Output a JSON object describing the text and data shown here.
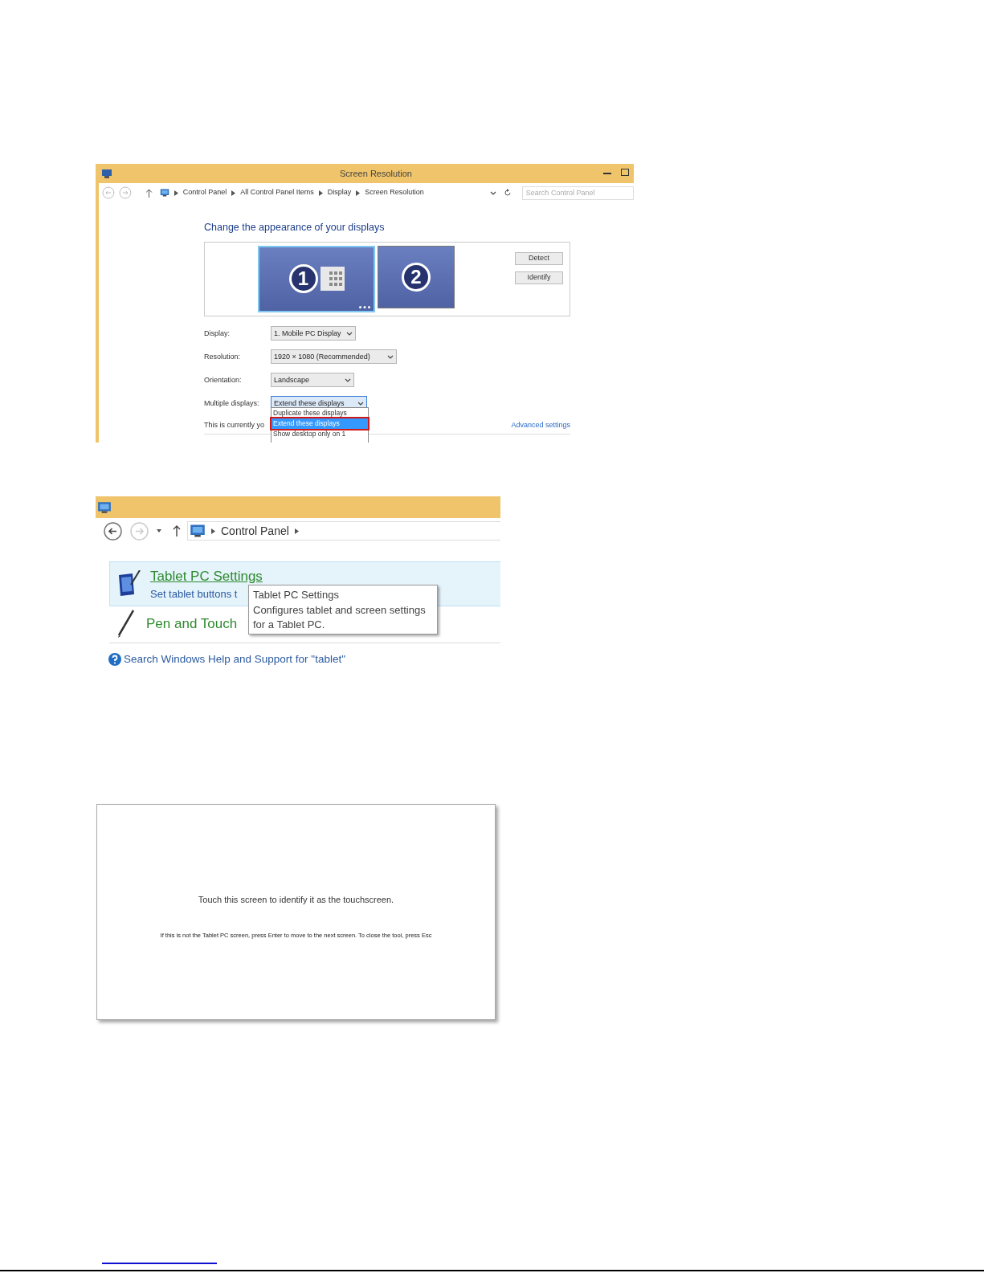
{
  "screen_resolution_window": {
    "title": "Screen Resolution",
    "breadcrumbs": [
      "Control Panel",
      "All Control Panel Items",
      "Display",
      "Screen Resolution"
    ],
    "search": {
      "placeholder": "Search Control Panel"
    },
    "heading": "Change the appearance of your displays",
    "monitors": [
      {
        "label": "1",
        "selected": true,
        "primary": true
      },
      {
        "label": "2",
        "selected": false,
        "primary": false
      }
    ],
    "buttons": [
      "Detect",
      "Identify"
    ],
    "fields": [
      {
        "label": "Display:",
        "value": "1. Mobile PC Display",
        "focused": false
      },
      {
        "label": "Resolution:",
        "value": "1920 × 1080 (Recommended)",
        "focused": false
      },
      {
        "label": "Orientation:",
        "value": "Landscape",
        "focused": false
      },
      {
        "label": "Multiple displays:",
        "value": "Extend these displays",
        "focused": true
      }
    ],
    "status_text": "This is currently yo",
    "advanced_link": "Advanced settings",
    "dropdown_options": [
      {
        "label": "Duplicate these displays",
        "selected": false
      },
      {
        "label": "Extend these displays",
        "selected": true
      },
      {
        "label": "Show desktop only on 1",
        "selected": false
      }
    ]
  },
  "control_panel_window": {
    "breadcrumbs": [
      "Control Panel"
    ],
    "results": [
      {
        "title": "Tablet PC Settings",
        "description": "Set tablet buttons t",
        "selected": true,
        "kind": "tablet"
      },
      {
        "title": "Pen and Touch",
        "selected": false,
        "kind": "pen"
      }
    ],
    "tooltip": {
      "title": "Tablet PC Settings",
      "text": "Configures tablet and screen settings\nfor a Tablet PC."
    },
    "help_link": "Search Windows Help and Support for \"tablet\""
  },
  "touch_screen_dialog": {
    "message": "Touch this screen to identify it as the touchscreen.",
    "hint": "If this is not the Tablet PC screen, press Enter to move to the next screen. To close the tool, press Esc"
  }
}
